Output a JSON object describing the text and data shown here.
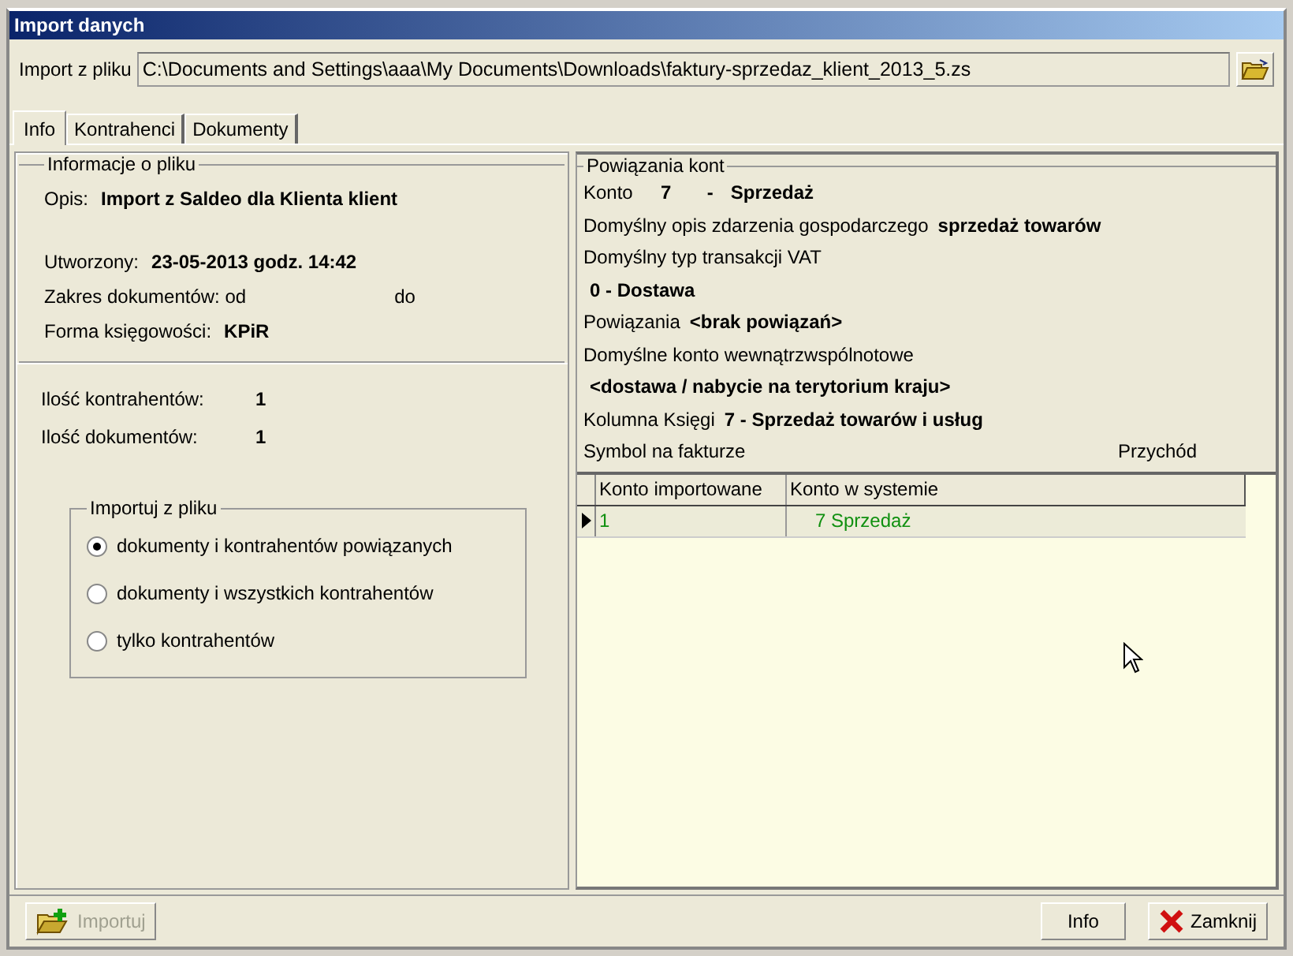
{
  "window": {
    "title": "Import danych"
  },
  "file": {
    "label": "Import z pliku",
    "value": "C:\\Documents and Settings\\aaa\\My Documents\\Downloads\\faktury-sprzedaz_klient_2013_5.zs"
  },
  "tabs": [
    {
      "label": "Info",
      "selected": true
    },
    {
      "label": "Kontrahenci",
      "selected": false
    },
    {
      "label": "Dokumenty",
      "selected": false
    }
  ],
  "file_info": {
    "title": "Informacje o pliku",
    "description": {
      "label": "Opis:",
      "value": "Import z Saldeo dla Klienta klient"
    },
    "created": {
      "label": "Utworzony:",
      "value": "23-05-2013 godz. 14:42"
    },
    "range": {
      "label": "Zakres dokumentów: od",
      "to": "do"
    },
    "accounting": {
      "label": "Forma księgowości:",
      "value": "KPiR"
    },
    "counts": [
      {
        "label": "Ilość kontrahentów:",
        "value": "1"
      },
      {
        "label": "Ilość dokumentów:",
        "value": "1"
      }
    ],
    "import_group": {
      "title": "Importuj z pliku",
      "options": [
        {
          "label": "dokumenty i kontrahentów powiązanych",
          "selected": true
        },
        {
          "label": "dokumenty i wszystkich kontrahentów",
          "selected": false
        },
        {
          "label": "tylko kontrahentów",
          "selected": false
        }
      ]
    }
  },
  "accounts": {
    "title": "Powiązania kont",
    "account": {
      "label": "Konto",
      "number": "7",
      "dash": "-",
      "name": "Sprzedaż"
    },
    "default_desc": {
      "label": "Domyślny opis zdarzenia gospodarczego",
      "value": "sprzedaż towarów"
    },
    "vat_type": {
      "label": "Domyślny typ  transakcji VAT",
      "value": "0 - Dostawa"
    },
    "links": {
      "label": "Powiązania",
      "value": "<brak powiązań>"
    },
    "intra": {
      "label": "Domyślne konto wewnątrzwspólnotowe",
      "value": "<dostawa / nabycie na terytorium kraju>"
    },
    "column": {
      "label": "Kolumna Księgi",
      "value": "7 - Sprzedaż towarów i usług"
    },
    "symbol": {
      "label": "Symbol na fakturze",
      "value": "Przychód"
    },
    "table": {
      "columns": [
        "Konto importowane",
        "Konto w systemie"
      ],
      "rows": [
        {
          "selected": true,
          "cells": [
            "1",
            "7 Sprzedaż"
          ]
        }
      ]
    }
  },
  "buttons": [
    {
      "label": "Importuj",
      "kind": "import",
      "disabled": true
    },
    {
      "label": "Info",
      "kind": "plain",
      "disabled": false
    },
    {
      "label": "Zamknij",
      "kind": "close",
      "disabled": false
    }
  ]
}
